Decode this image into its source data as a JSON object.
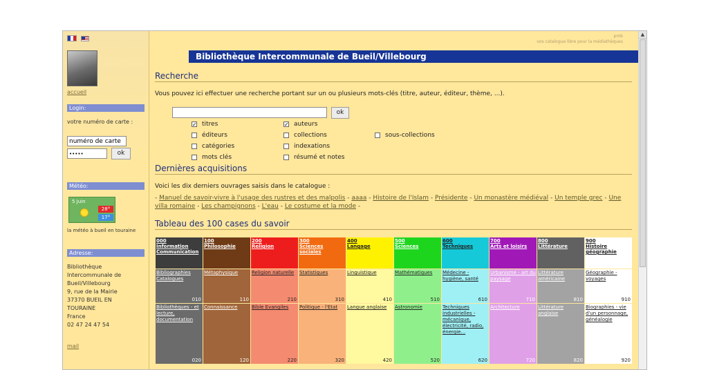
{
  "sidebar": {
    "accueil": "accueil",
    "login_title": "Login:",
    "card_label": "votre numéro de carte :",
    "card_value": "numéro de carte",
    "password_value": "•••••",
    "ok": "ok",
    "meteo_title": "Météo:",
    "meteo_date": "5 Juin",
    "meteo_max": "28°",
    "meteo_min": "17°",
    "meteo_caption": "la météo à bueil en touraine",
    "adresse_title": "Adresse:",
    "address_lines": [
      "Bibliothèque",
      "Intercommunale de",
      "Bueil/Villebourg",
      "9, rue de la Mairie",
      "37370 BUEIL EN",
      "TOURAINE",
      "France",
      "02 47 24 47 54"
    ],
    "mail": "mail"
  },
  "header": {
    "topright_1": "pmb",
    "topright_2": "vos catalogue libre pour la médiathèques",
    "title": "Bibliothèque Intercommunale de Bueil/Villebourg"
  },
  "search": {
    "heading": "Recherche",
    "intro": "Vous pouvez ici effectuer une recherche portant sur un ou plusieurs mots-clés (titre, auteur, éditeur, thème, ...).",
    "ok": "ok",
    "options": [
      {
        "label": "titres",
        "checked": true
      },
      {
        "label": "auteurs",
        "checked": true
      },
      {
        "label": "éditeurs",
        "checked": false
      },
      {
        "label": "collections",
        "checked": false
      },
      {
        "label": "sous-collections",
        "checked": false
      },
      {
        "label": "catégories",
        "checked": false
      },
      {
        "label": "indexations",
        "checked": false
      },
      {
        "label": "mots clés",
        "checked": false
      },
      {
        "label": "résumé et notes",
        "checked": false
      }
    ]
  },
  "acquisitions": {
    "heading": "Dernières acquisitions",
    "intro": "Voici les dix derniers ouvrages saisis dans le catalogue :",
    "items": [
      "Manuel de savoir-vivre à l'usage des rustres et des malpolis",
      "aaaa",
      "Histoire de l'Islam",
      "Présidente",
      "Un monastère médiéval",
      "Un temple grec",
      "Une villa romaine",
      "Les champignons",
      "L'eau",
      "Le costume et la mode"
    ]
  },
  "savoir": {
    "heading": "Tableau des 100 cases du savoir",
    "columns": [
      {
        "code": "000",
        "name": "Information Communication",
        "bg": "#3d3d3d",
        "hdr_color": "#ffffff",
        "body_bg": "#6b6b6b",
        "body_color": "#ffffff",
        "r1": "Bibliographies Catalogues",
        "r1_code": "010",
        "r2": "Bibliothèques - et lecture, documentation",
        "r2_code": "020"
      },
      {
        "code": "100",
        "name": "Philosophie",
        "bg": "#6e3b16",
        "hdr_color": "#ffffff",
        "body_bg": "#a0653a",
        "body_color": "#ffffff",
        "r1": "Métaphysique",
        "r1_code": "110",
        "r2": "Connaissance",
        "r2_code": "120"
      },
      {
        "code": "200",
        "name": "Religion",
        "bg": "#ee1d1d",
        "hdr_color": "#ffffff",
        "body_bg": "#f48a70",
        "body_color": "#222222",
        "r1": "Religion naturelle",
        "r1_code": "210",
        "r2": "Bible Evangiles",
        "r2_code": "220"
      },
      {
        "code": "300",
        "name": "Sciences sociales",
        "bg": "#f26a10",
        "hdr_color": "#ffffff",
        "body_bg": "#f9b27a",
        "body_color": "#222222",
        "r1": "Statistiques",
        "r1_code": "310",
        "r2": "Politique - l'Etat",
        "r2_code": "320"
      },
      {
        "code": "400",
        "name": "Langage",
        "bg": "#fff200",
        "hdr_color": "#222222",
        "body_bg": "#fff9a0",
        "body_color": "#222222",
        "r1": "Linguistique",
        "r1_code": "410",
        "r2": "Langue anglaise",
        "r2_code": "420"
      },
      {
        "code": "500",
        "name": "Sciences",
        "bg": "#1ed51e",
        "hdr_color": "#ffffff",
        "body_bg": "#8ff08b",
        "body_color": "#222222",
        "r1": "Mathématiques",
        "r1_code": "510",
        "r2": "Astronomie",
        "r2_code": "520"
      },
      {
        "code": "600",
        "name": "Techniques",
        "bg": "#16c9d8",
        "hdr_color": "#222222",
        "body_bg": "#9ff0f5",
        "body_color": "#222222",
        "r1": "Médecine - hygiène, santé",
        "r1_code": "610",
        "r2": "Techniques industrielles - mécanique, électricité, radio, énergie...",
        "r2_code": "620"
      },
      {
        "code": "700",
        "name": "Arts et loisirs",
        "bg": "#a019b7",
        "hdr_color": "#ffffff",
        "body_bg": "#e0a0e8",
        "body_color": "#ffffff",
        "r1": "Urbanisme - art du paysage",
        "r1_code": "710",
        "r2": "Architecture",
        "r2_code": "720"
      },
      {
        "code": "800",
        "name": "Littérature",
        "bg": "#616161",
        "hdr_color": "#ffffff",
        "body_bg": "#a3a3a3",
        "body_color": "#ffffff",
        "r1": "Littérature américaine",
        "r1_code": "810",
        "r2": "Littérature anglaise",
        "r2_code": "820"
      },
      {
        "code": "900",
        "name": "Histoire géographie",
        "bg": "#ffffff",
        "hdr_color": "#222222",
        "body_bg": "#ffffff",
        "body_color": "#222222",
        "r1": "Géographie - voyages",
        "r1_code": "910",
        "r2": "Biographies - vie d'un personnage, généalogie",
        "r2_code": "920"
      }
    ]
  }
}
